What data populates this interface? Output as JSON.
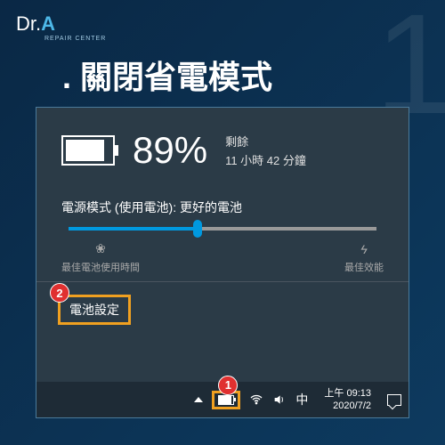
{
  "logo": {
    "prefix": "Dr.",
    "mark": "A",
    "subtitle": "REPAIR CENTER"
  },
  "step_number": "1",
  "title": {
    "dot": ".",
    "text": "關閉省電模式"
  },
  "battery": {
    "percent": "89%",
    "remaining_label": "剩餘",
    "remaining_time": "11 小時 42 分鐘"
  },
  "power_mode": {
    "label": "電源模式 (使用電池): 更好的電池",
    "left_label": "最佳電池使用時間",
    "right_label": "最佳效能"
  },
  "settings_link": "電池設定",
  "callouts": {
    "one": "1",
    "two": "2"
  },
  "taskbar": {
    "ime": "中",
    "time": "上午 09:13",
    "date": "2020/7/2"
  },
  "colors": {
    "highlight": "#f0a020",
    "badge": "#e03030",
    "accent": "#0099e0"
  }
}
